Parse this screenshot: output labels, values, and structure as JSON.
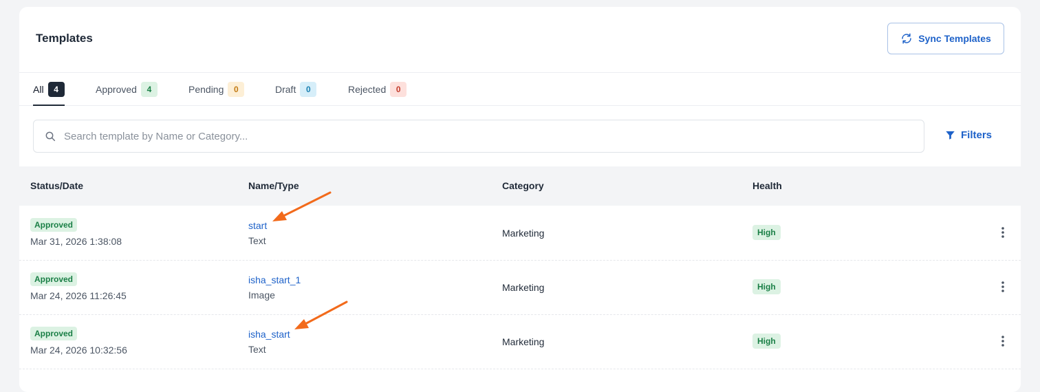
{
  "header": {
    "title": "Templates",
    "sync_label": "Sync Templates"
  },
  "tabs": [
    {
      "label": "All",
      "count": "4",
      "bg": "#1f2937",
      "fg": "#ffffff",
      "active": true
    },
    {
      "label": "Approved",
      "count": "4",
      "bg": "#dcf2e3",
      "fg": "#1a7f46"
    },
    {
      "label": "Pending",
      "count": "0",
      "bg": "#fdefd6",
      "fg": "#c27a12"
    },
    {
      "label": "Draft",
      "count": "0",
      "bg": "#d6eef9",
      "fg": "#1a7fb0"
    },
    {
      "label": "Rejected",
      "count": "0",
      "bg": "#fde0dc",
      "fg": "#c23a2b"
    }
  ],
  "search": {
    "placeholder": "Search template by Name or Category..."
  },
  "filters_label": "Filters",
  "table": {
    "columns": [
      "Status/Date",
      "Name/Type",
      "Category",
      "Health"
    ],
    "rows": [
      {
        "status": "Approved",
        "date": "Mar 31, 2026 1:38:08",
        "name": "start",
        "type": "Text",
        "category": "Marketing",
        "health": "High"
      },
      {
        "status": "Approved",
        "date": "Mar 24, 2026 11:26:45",
        "name": "isha_start_1",
        "type": "Image",
        "category": "Marketing",
        "health": "High"
      },
      {
        "status": "Approved",
        "date": "Mar 24, 2026 10:32:56",
        "name": "isha_start",
        "type": "Text",
        "category": "Marketing",
        "health": "High"
      }
    ]
  },
  "colors": {
    "accent": "#1e62c9",
    "annotation_arrow": "#f26a1b"
  }
}
